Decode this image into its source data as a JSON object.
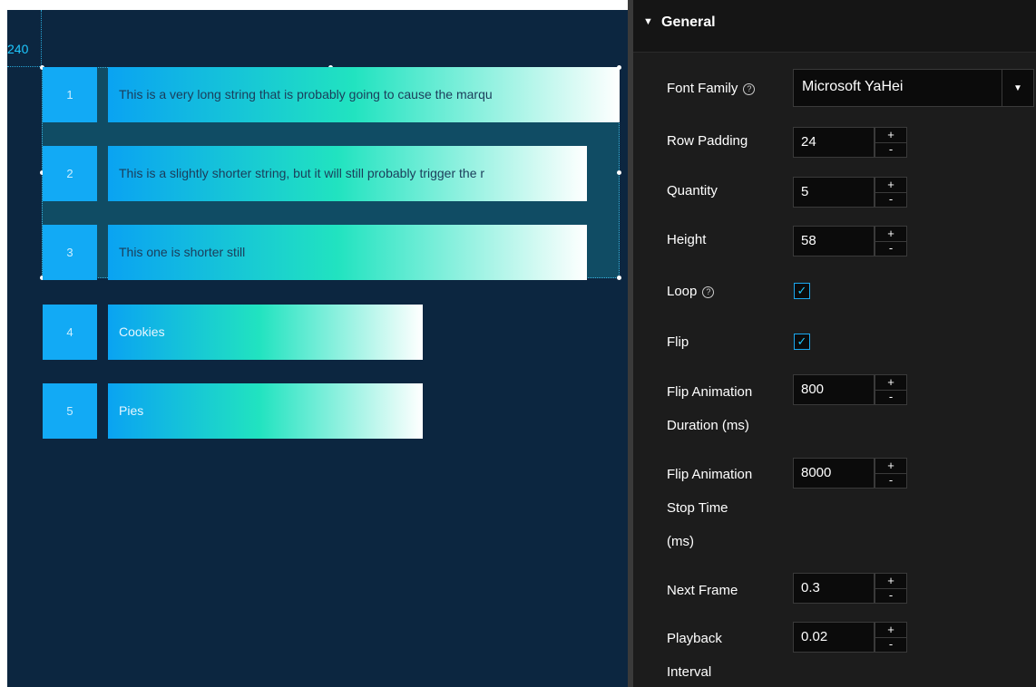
{
  "canvas": {
    "ruler_value": "240",
    "rows": [
      {
        "index": "1",
        "text": "This is a very long string that is probably going to cause the marqu"
      },
      {
        "index": "2",
        "text": "This is a slightly shorter string, but it will still probably trigger the r"
      },
      {
        "index": "3",
        "text": "This one is shorter still"
      },
      {
        "index": "4",
        "text": "Cookies"
      },
      {
        "index": "5",
        "text": "Pies"
      }
    ]
  },
  "panel": {
    "section_title": "General",
    "font_family": {
      "label": "Font Family",
      "value": "Microsoft YaHei"
    },
    "row_padding": {
      "label": "Row Padding",
      "value": "24"
    },
    "quantity": {
      "label": "Quantity",
      "value": "5"
    },
    "height": {
      "label": "Height",
      "value": "58"
    },
    "loop": {
      "label": "Loop",
      "checked": true
    },
    "flip": {
      "label": "Flip",
      "checked": true
    },
    "flip_duration": {
      "label_line1": "Flip Animation",
      "label_line2": "Duration (ms)",
      "value": "800"
    },
    "flip_stop": {
      "label_line1": "Flip Animation",
      "label_line2": "Stop Time",
      "label_line3": "(ms)",
      "value": "8000"
    },
    "next_frame": {
      "label": "Next Frame",
      "value": "0.3"
    },
    "playback": {
      "label_line1": "Playback",
      "label_line2": "Interval",
      "value": "0.02"
    },
    "stepper_plus": "+",
    "stepper_minus": "-",
    "help_glyph": "?",
    "check_glyph": "✓",
    "accent_color": "#12aaf5",
    "icons": {
      "collapse": "chevron-down-icon",
      "dropdown": "caret-down-icon",
      "help": "question-circle-icon"
    }
  }
}
